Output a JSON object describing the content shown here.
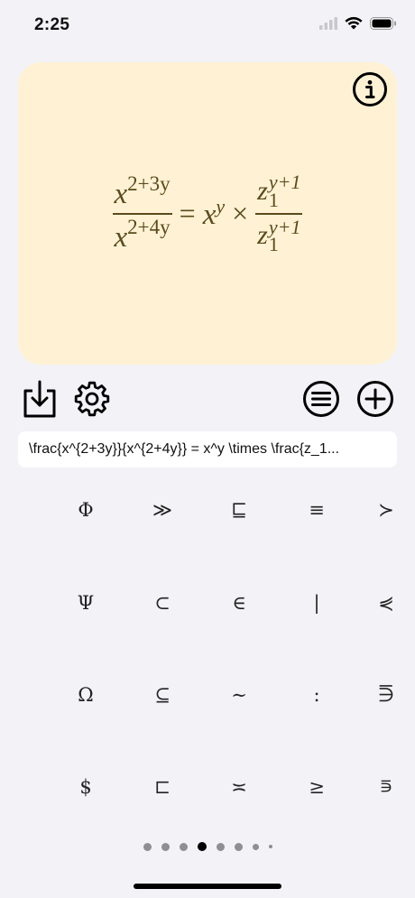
{
  "status_bar": {
    "time": "2:25"
  },
  "formula_card": {
    "background": "#fff2d4",
    "ink_color": "#5a4a1c",
    "info_icon": "info-circle-icon",
    "formula": {
      "lhs_num_base": "x",
      "lhs_num_exp": "2+3y",
      "lhs_den_base": "x",
      "lhs_den_exp": "2+4y",
      "equals": "=",
      "rhs_base": "x",
      "rhs_exp": "y",
      "times": "×",
      "rhs_num_base": "z",
      "rhs_num_sup": "y+1",
      "rhs_num_sub": "1",
      "rhs_den_base": "z",
      "rhs_den_sup": "y+1",
      "rhs_den_sub": "1"
    }
  },
  "toolbar": {
    "export_icon": "download-tray-icon",
    "settings_icon": "gear-icon",
    "list_icon": "list-circle-icon",
    "add_icon": "plus-circle-icon"
  },
  "latex_input": {
    "value": "\\frac{x^{2+3y}}{x^{2+4y}} = x^y \\times \\frac{z_1..."
  },
  "symbol_grid": {
    "rows": [
      [
        "Φ",
        "≫",
        "⊑",
        "≡",
        "≻"
      ],
      [
        "Ψ",
        "⊂",
        "∈",
        "|",
        "⋞"
      ],
      [
        "Ω",
        "⊆",
        "∼",
        ":",
        "⋽"
      ],
      [
        "$",
        "⊏",
        "≍",
        "≥",
        "⋾"
      ]
    ]
  },
  "pagination": {
    "total_pages": 8,
    "current_page": 4
  }
}
